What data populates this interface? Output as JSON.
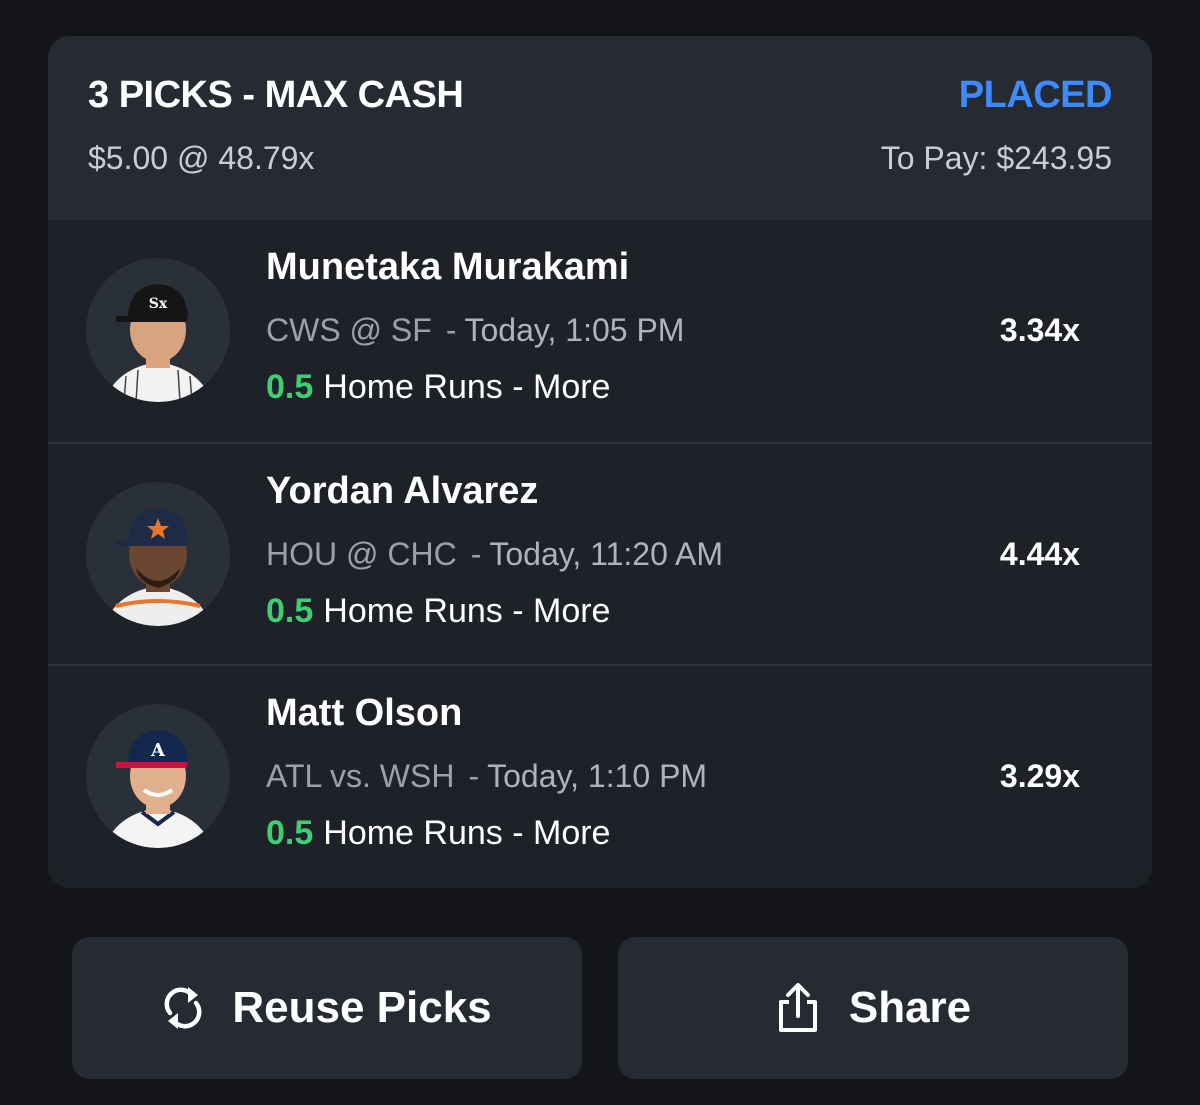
{
  "entry": {
    "title": "3 PICKS - MAX CASH",
    "status": "PLACED",
    "wager": "$5.00 @ 48.79x",
    "payout": "To Pay: $243.95"
  },
  "picks": [
    {
      "player": "Munetaka Murakami",
      "matchup": "CWS @ SF",
      "separator": "-",
      "time": "Today, 1:05 PM",
      "line": "0.5",
      "stat": "Home Runs - More",
      "multiplier": "3.34x",
      "cap_color": "#151515",
      "jersey_color": "#f2f2f2",
      "skin_color": "#d8a47f"
    },
    {
      "player": "Yordan Alvarez",
      "matchup": "HOU @ CHC",
      "separator": "-",
      "time": "Today, 11:20 AM",
      "line": "0.5",
      "stat": "Home Runs - More",
      "multiplier": "4.44x",
      "cap_color": "#1f2a44",
      "jersey_color": "#eeeeee",
      "skin_color": "#6b4631"
    },
    {
      "player": "Matt Olson",
      "matchup": "ATL vs. WSH",
      "separator": "-",
      "time": "Today, 1:10 PM",
      "line": "0.5",
      "stat": "Home Runs - More",
      "multiplier": "3.29x",
      "cap_color": "#13274f",
      "jersey_color": "#f4f4f4",
      "skin_color": "#e0b08f"
    }
  ],
  "actions": {
    "reuse_label": "Reuse Picks",
    "reuse_icon": "refresh-icon",
    "share_label": "Share",
    "share_icon": "share-icon"
  },
  "colors": {
    "accent": "#3d8bfd",
    "positive": "#3ccf74",
    "background": "#141619",
    "card": "#1e2228"
  }
}
